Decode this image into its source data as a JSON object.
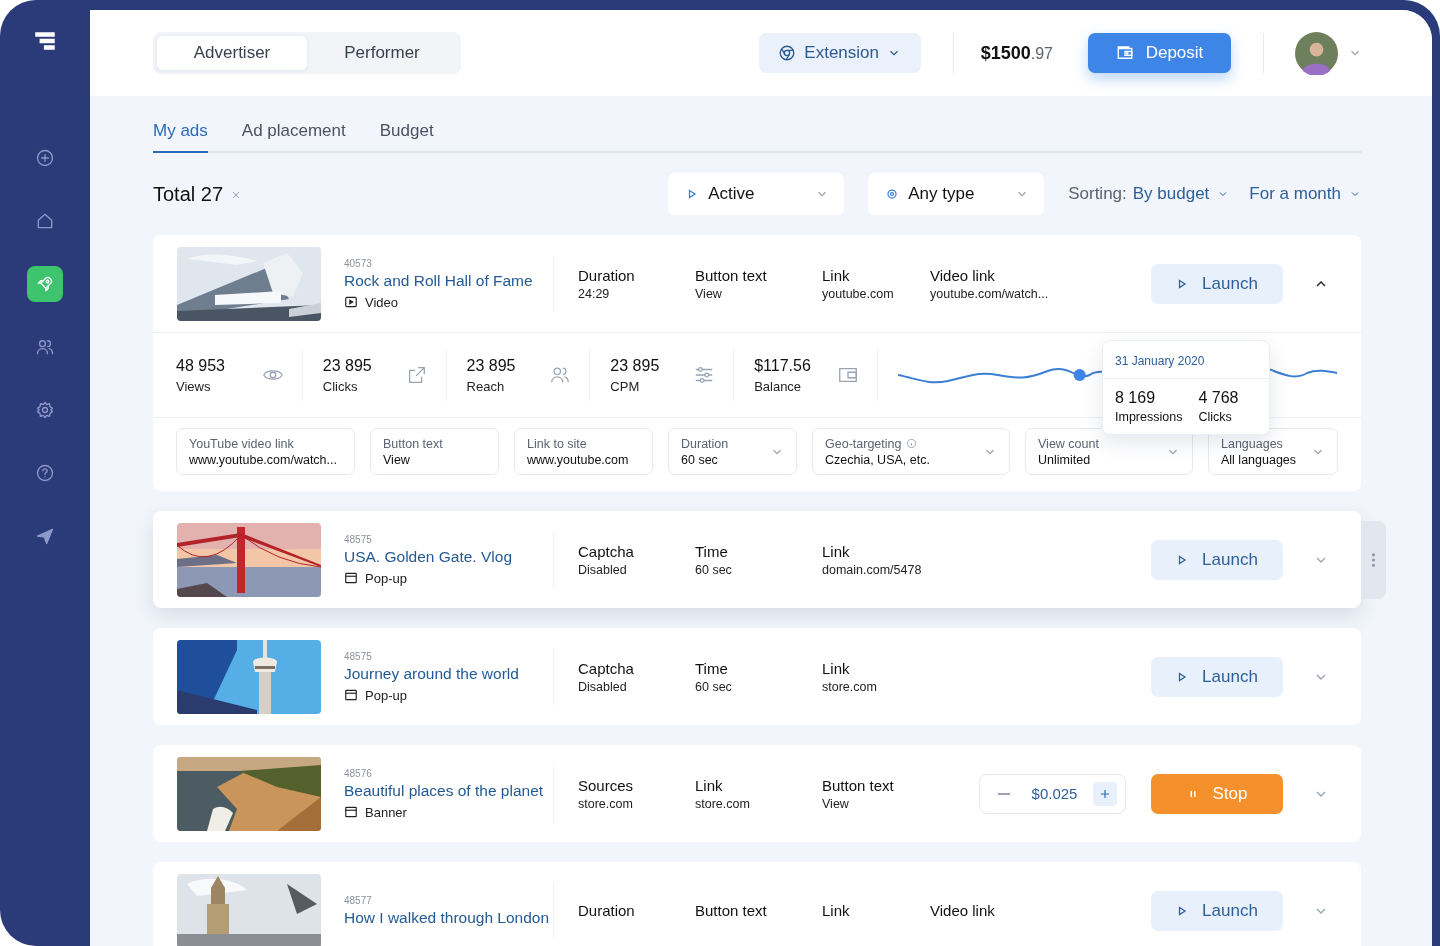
{
  "sidebar": {
    "items": [
      {
        "selected": false
      },
      {
        "selected": false
      },
      {
        "selected": true
      },
      {
        "selected": false
      },
      {
        "selected": false
      },
      {
        "selected": false
      },
      {
        "selected": false
      }
    ]
  },
  "header": {
    "roles": [
      {
        "label": "Advertiser",
        "selected": true
      },
      {
        "label": "Performer",
        "selected": false
      }
    ],
    "extension": "Extension",
    "balance": {
      "whole": "$1500",
      "cents": ".97"
    },
    "deposit": "Deposit"
  },
  "tabs": [
    {
      "label": "My ads",
      "selected": true
    },
    {
      "label": "Ad placement",
      "selected": false
    },
    {
      "label": "Budget",
      "selected": false
    }
  ],
  "filters": {
    "total": "Total 27",
    "status": "Active",
    "type": "Any type",
    "sorting_label": "Sorting:",
    "sorting_value": "By budget",
    "period": "For a month"
  },
  "ads": [
    {
      "id": "40573",
      "title": "Rock and Roll Hall of Fame",
      "type": {
        "kind": "video",
        "label": "Video"
      },
      "fields": [
        {
          "label": "Duration",
          "value": "24:29"
        },
        {
          "label": "Button text",
          "value": "View"
        },
        {
          "label": "Link",
          "value": "youtube.com"
        },
        {
          "label": "Video link",
          "value": "youtube.com/watch..."
        }
      ],
      "action": {
        "kind": "launch",
        "label": "Launch"
      },
      "expanded": true,
      "selected": false,
      "details": {
        "stats": [
          {
            "value": "48 953",
            "label": "Views"
          },
          {
            "value": "23 895",
            "label": "Clicks"
          },
          {
            "value": "23 895",
            "label": "Reach"
          },
          {
            "value": "23 895",
            "label": "CPM"
          },
          {
            "value": "$117.56",
            "label": "Balance"
          }
        ],
        "tooltip": {
          "date": "31 January 2020",
          "items": [
            {
              "value": "8 169",
              "label": "Impressions"
            },
            {
              "value": "4 768",
              "label": "Clicks"
            }
          ]
        },
        "settings": [
          {
            "label": "YouTube video link",
            "value": "www.youtube.com/watch...",
            "dropdown": false,
            "info": false
          },
          {
            "label": "Button text",
            "value": "View",
            "dropdown": false,
            "info": false
          },
          {
            "label": "Link to site",
            "value": "www.youtube.com",
            "dropdown": false,
            "info": false
          },
          {
            "label": "Duration",
            "value": "60 sec",
            "dropdown": true,
            "info": false
          },
          {
            "label": "Geo-targeting",
            "value": "Czechia, USA, etc.",
            "dropdown": true,
            "info": true
          },
          {
            "label": "View count",
            "value": "Unlimited",
            "dropdown": true,
            "info": false
          },
          {
            "label": "Languages",
            "value": "All languages",
            "dropdown": true,
            "info": false
          }
        ]
      }
    },
    {
      "id": "48575",
      "title": "USA. Golden Gate. Vlog",
      "type": {
        "kind": "popup",
        "label": "Pop-up"
      },
      "fields": [
        {
          "label": "Captcha",
          "value": "Disabled"
        },
        {
          "label": "Time",
          "value": "60 sec"
        },
        {
          "label": "Link",
          "value": "domain.com/5478"
        }
      ],
      "action": {
        "kind": "launch",
        "label": "Launch"
      },
      "expanded": false,
      "selected": true
    },
    {
      "id": "48575",
      "title": "Journey around the world",
      "type": {
        "kind": "popup",
        "label": "Pop-up"
      },
      "fields": [
        {
          "label": "Captcha",
          "value": "Disabled"
        },
        {
          "label": "Time",
          "value": "60 sec"
        },
        {
          "label": "Link",
          "value": "store.com"
        }
      ],
      "action": {
        "kind": "launch",
        "label": "Launch"
      },
      "expanded": false,
      "selected": false
    },
    {
      "id": "48576",
      "title": "Beautiful places of the planet",
      "type": {
        "kind": "banner",
        "label": "Banner"
      },
      "fields": [
        {
          "label": "Sources",
          "value": "store.com"
        },
        {
          "label": "Link",
          "value": "store.com"
        },
        {
          "label": "Button text",
          "value": "View"
        }
      ],
      "price": "$0.025",
      "action": {
        "kind": "stop",
        "label": "Stop"
      },
      "expanded": false,
      "selected": false
    },
    {
      "id": "48577",
      "title": "How I walked through London",
      "fields": [
        {
          "label": "Duration"
        },
        {
          "label": "Button text"
        },
        {
          "label": "Link"
        },
        {
          "label": "Video link"
        }
      ],
      "action": {
        "kind": "launch",
        "label": "Launch"
      },
      "expanded": false,
      "selected": false
    }
  ]
}
